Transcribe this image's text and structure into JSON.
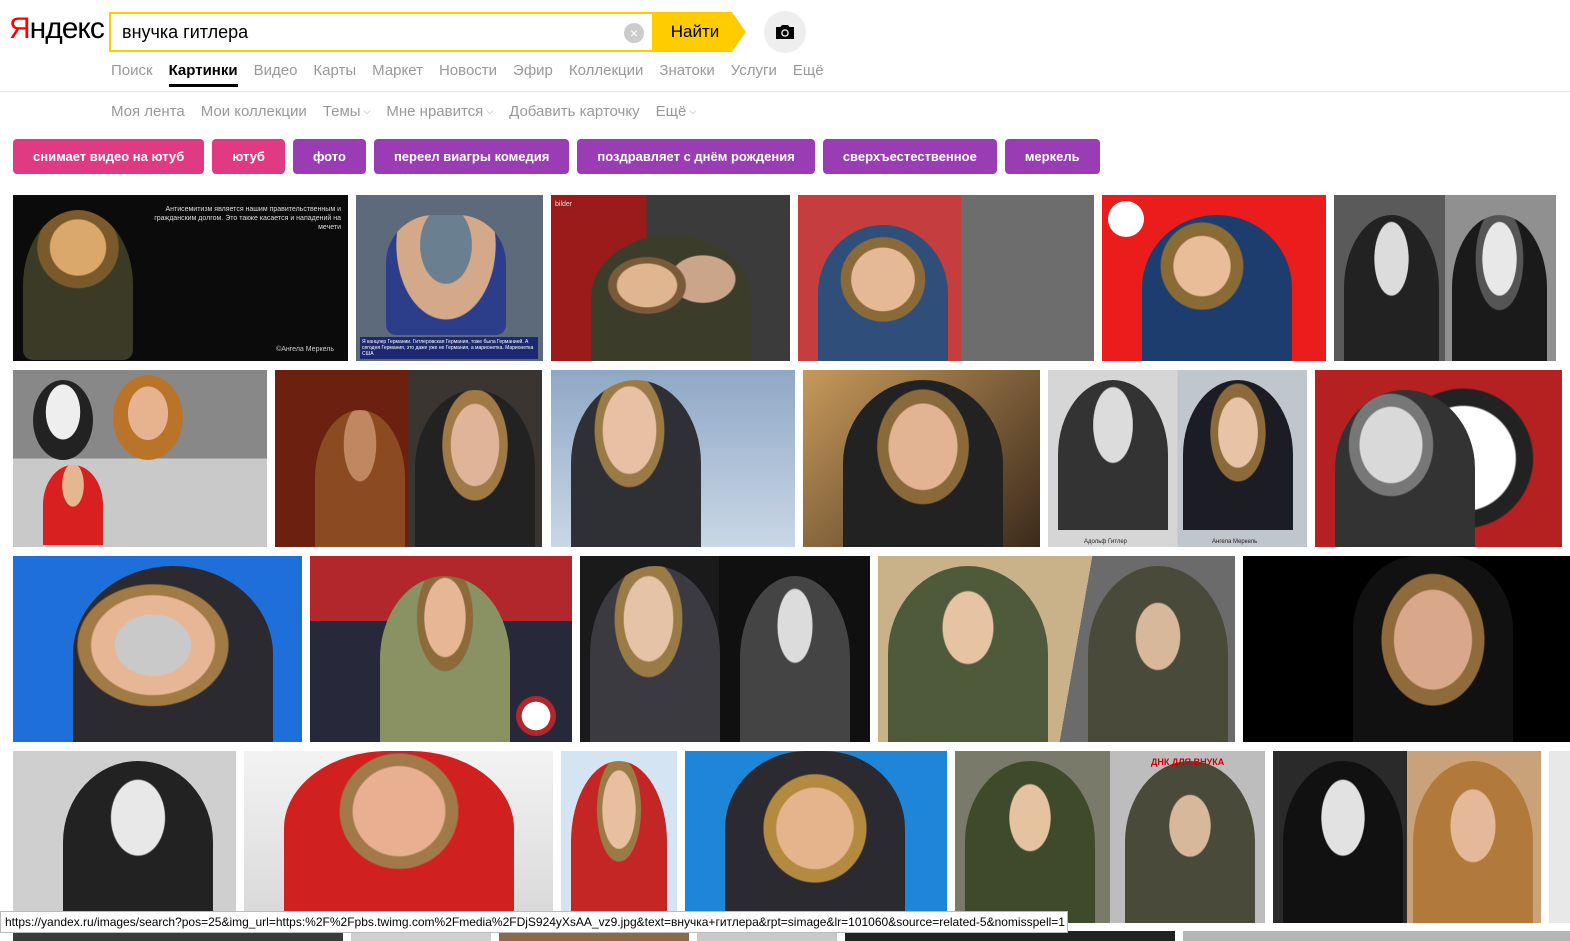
{
  "logo": {
    "first": "Я",
    "rest": "ндекс"
  },
  "search": {
    "value": "внучка гитлера",
    "clear_icon": "×",
    "button": "Найти"
  },
  "services": [
    "Поиск",
    "Картинки",
    "Видео",
    "Карты",
    "Маркет",
    "Новости",
    "Эфир",
    "Коллекции",
    "Знатоки",
    "Услуги",
    "Ещё"
  ],
  "active_service": "Картинки",
  "subnav": {
    "feed": "Моя лента",
    "collections": "Мои коллекции",
    "themes": "Темы",
    "likes": "Мне нравится",
    "add_card": "Добавить карточку",
    "more": "Ещё",
    "caret": "⌵"
  },
  "chips": [
    {
      "label": "снимает видео на ютуб",
      "color": "#e03b82"
    },
    {
      "label": "ютуб",
      "color": "#e03b82"
    },
    {
      "label": "фото",
      "color": "#9a3db4"
    },
    {
      "label": "переел виагры комедия",
      "color": "#9a3db4"
    },
    {
      "label": "поздравляет с днём рождения",
      "color": "#9a3db4"
    },
    {
      "label": "сверхъестественное",
      "color": "#9a3db4"
    },
    {
      "label": "меркель",
      "color": "#9a3db4"
    }
  ],
  "tiles_text": {
    "t1": "Антисемитизм является нашим правительственным и гражданским долгом. Это также касается и нападений на мечети",
    "t1_sign": "©Ангела Меркель",
    "t2": "Я канцлер Германии. Гитлеровская Германия, тоже была Германией. А сегодня Германия, это даже уже не Германия, а марионетка. Марионетка США",
    "t3": "bilder",
    "t10_left": "Адольф Гитлер",
    "t10_right": "Ангела Меркель",
    "t22": "ДНК ДЛЯ ВНУКА"
  },
  "status_url": "https://yandex.ru/images/search?pos=25&img_url=https:%2F%2Fpbs.twimg.com%2Fmedia%2FDjS924yXsAA_vz9.jpg&text=внучка+гитлера&rpt=simage&lr=101060&source=related-5&nomisspell=1"
}
